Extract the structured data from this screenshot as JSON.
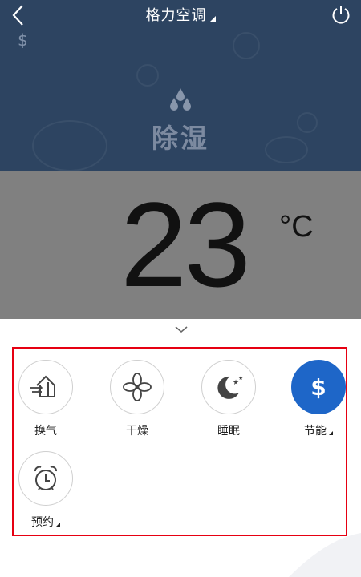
{
  "header": {
    "title": "格力空调",
    "back_icon": "chevron-left-icon",
    "power_icon": "power-icon"
  },
  "status": {
    "dollar_symbol": "$",
    "mode_icon": "water-drops-icon",
    "mode_label": "除湿"
  },
  "temperature": {
    "value": "23",
    "unit": "°C"
  },
  "functions": [
    {
      "label": "换气",
      "icon": "house-airflow-icon",
      "active": false,
      "has_menu": false
    },
    {
      "label": "干燥",
      "icon": "fan-icon",
      "active": false,
      "has_menu": false
    },
    {
      "label": "睡眠",
      "icon": "moon-stars-icon",
      "active": false,
      "has_menu": false
    },
    {
      "label": "节能",
      "icon": "dollar-icon",
      "active": true,
      "has_menu": true
    },
    {
      "label": "预约",
      "icon": "alarm-clock-icon",
      "active": false,
      "has_menu": true
    }
  ],
  "colors": {
    "header_bg": "#2d4461",
    "overlay_gray": "#808080",
    "active_blue": "#1e66c8",
    "highlight_red": "#e60012"
  }
}
